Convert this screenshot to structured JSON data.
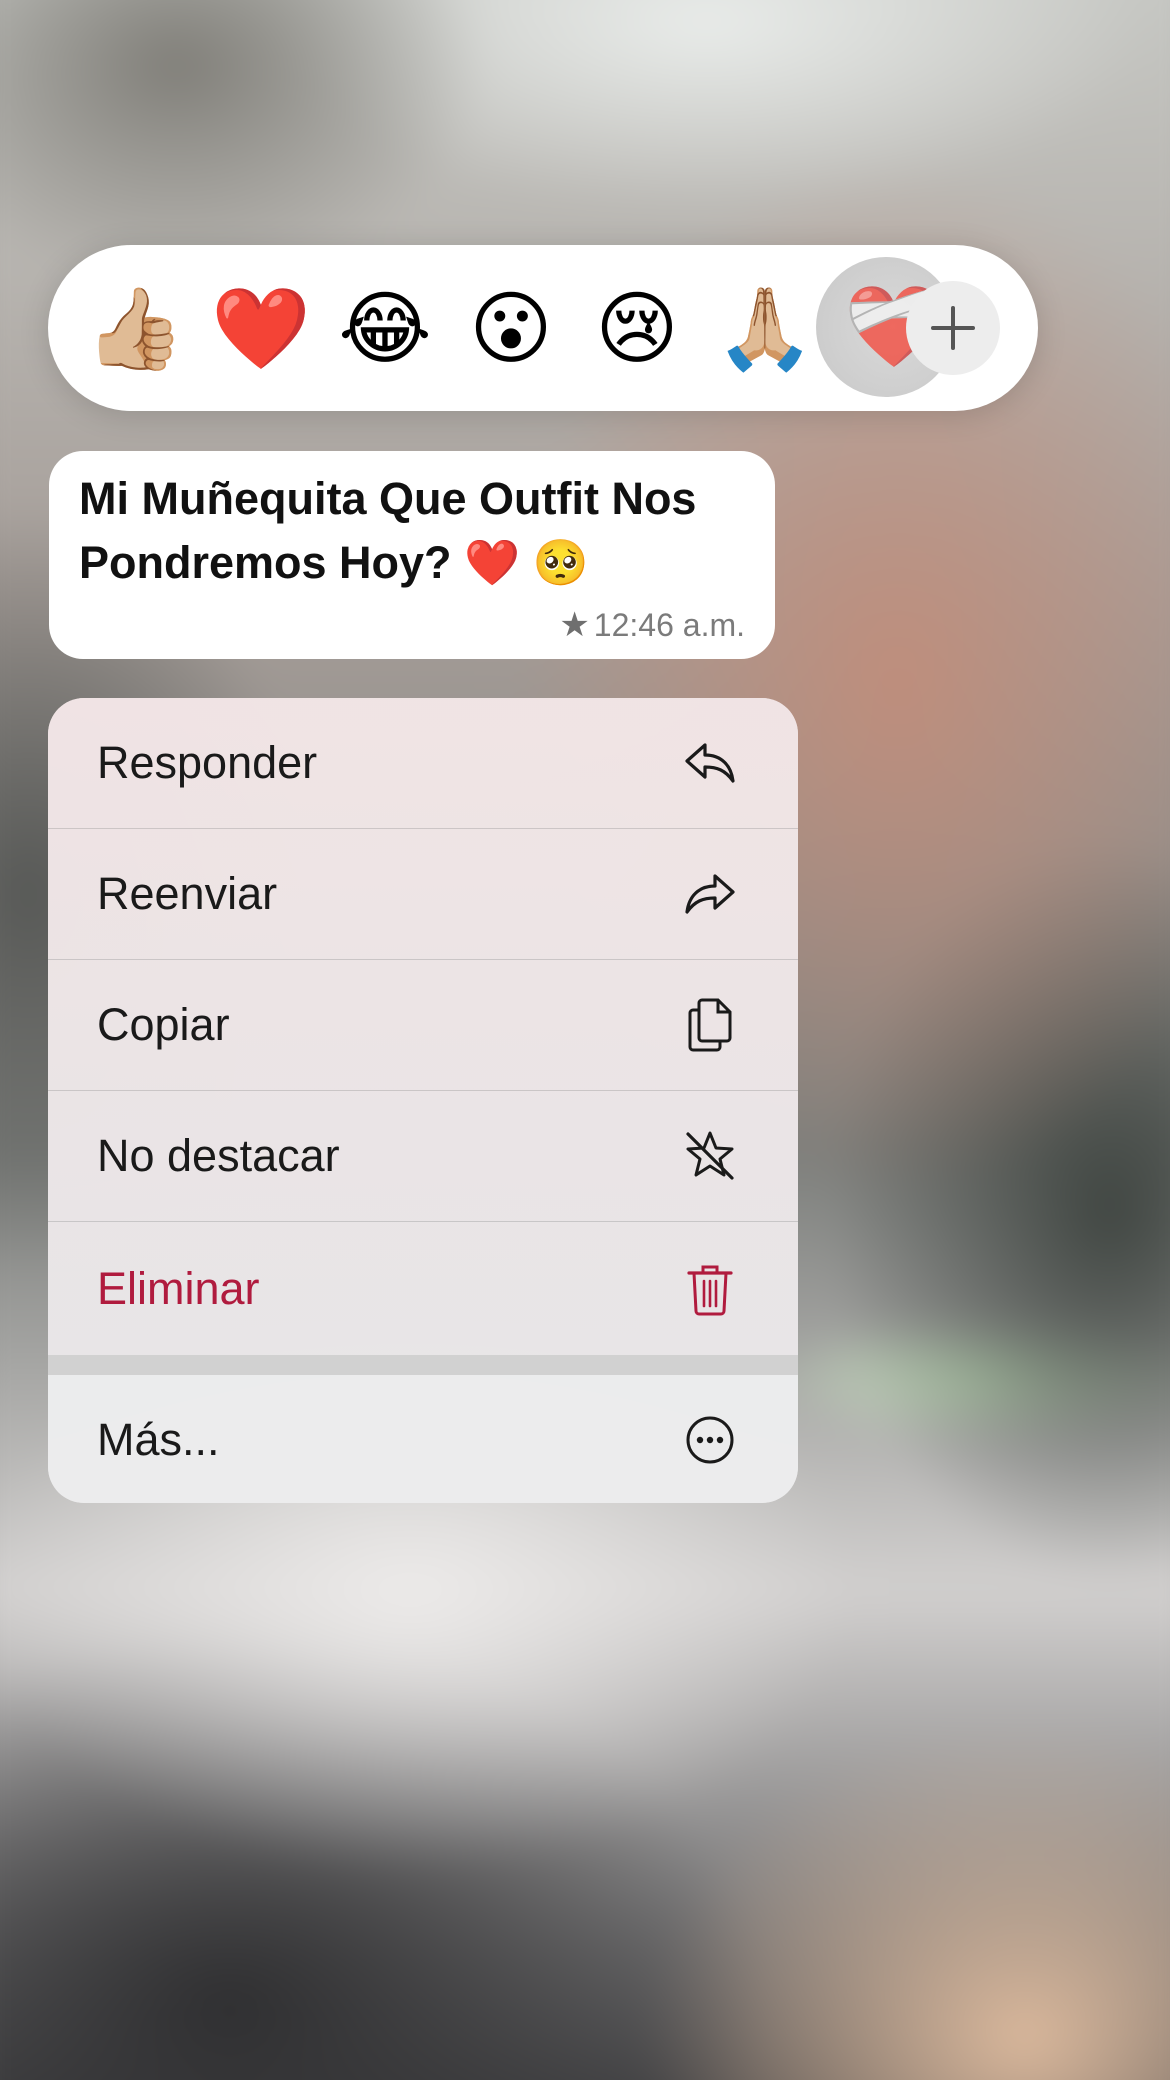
{
  "reactions": {
    "items": [
      {
        "emoji": "👍🏼",
        "name": "thumbs-up"
      },
      {
        "emoji": "❤️",
        "name": "red-heart"
      },
      {
        "emoji": "😂",
        "name": "tears-of-joy"
      },
      {
        "emoji": "😮",
        "name": "surprised"
      },
      {
        "emoji": "😢",
        "name": "crying"
      },
      {
        "emoji": "🙏🏼",
        "name": "folded-hands"
      }
    ],
    "selected": {
      "emoji": "❤️‍🩹",
      "name": "mending-heart"
    },
    "add_icon": "plus-icon"
  },
  "message": {
    "text": "Mi Muñequita Que Outfit Nos Pondremos Hoy? ❤️ 🥺",
    "starred_icon": "★",
    "time": "12:46 a.m."
  },
  "menu": {
    "items": [
      {
        "label": "Responder",
        "icon": "reply-icon"
      },
      {
        "label": "Reenviar",
        "icon": "forward-icon"
      },
      {
        "label": "Copiar",
        "icon": "copy-icon"
      },
      {
        "label": "No destacar",
        "icon": "unstar-icon"
      },
      {
        "label": "Eliminar",
        "icon": "trash-icon",
        "color": "#b01b3e"
      }
    ],
    "more": {
      "label": "Más...",
      "icon": "more-icon"
    }
  }
}
